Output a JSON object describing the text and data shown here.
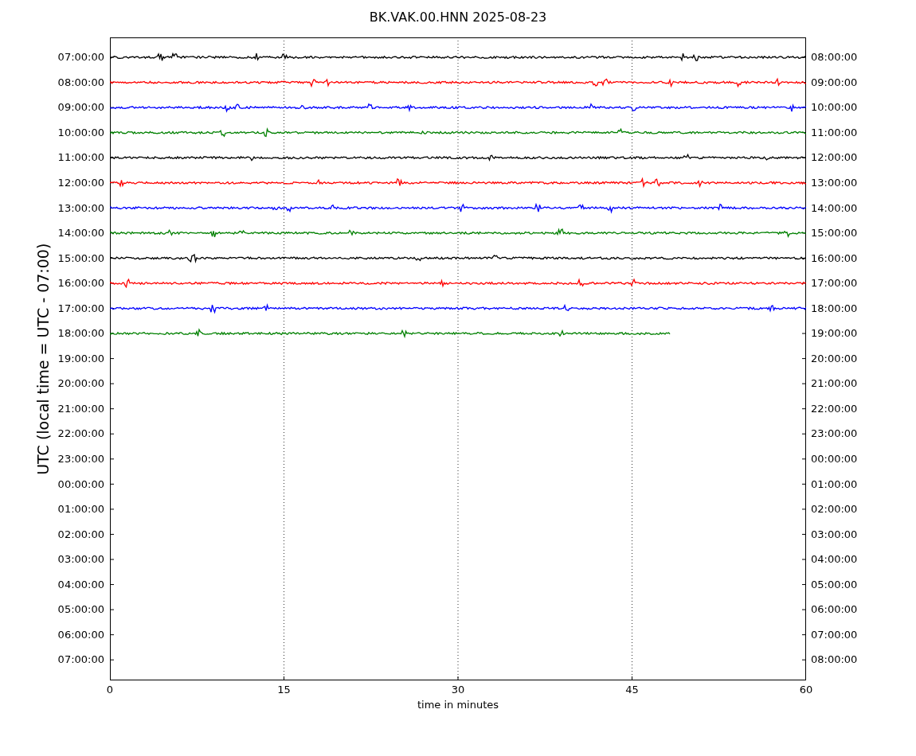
{
  "title": "BK.VAK.00.HNN 2025-08-23",
  "ylabel": "UTC (local time = UTC - 07:00)",
  "xlabel": "time in minutes",
  "xticks": [
    "0",
    "15",
    "30",
    "45",
    "60"
  ],
  "left_labels": [
    "07:00:00",
    "08:00:00",
    "09:00:00",
    "10:00:00",
    "11:00:00",
    "12:00:00",
    "13:00:00",
    "14:00:00",
    "15:00:00",
    "16:00:00",
    "17:00:00",
    "18:00:00",
    "19:00:00",
    "20:00:00",
    "21:00:00",
    "22:00:00",
    "23:00:00",
    "00:00:00",
    "01:00:00",
    "02:00:00",
    "03:00:00",
    "04:00:00",
    "05:00:00",
    "06:00:00",
    "07:00:00"
  ],
  "right_labels": [
    "08:00:00",
    "09:00:00",
    "10:00:00",
    "11:00:00",
    "12:00:00",
    "13:00:00",
    "14:00:00",
    "15:00:00",
    "16:00:00",
    "17:00:00",
    "18:00:00",
    "19:00:00",
    "20:00:00",
    "21:00:00",
    "22:00:00",
    "23:00:00",
    "00:00:00",
    "01:00:00",
    "02:00:00",
    "03:00:00",
    "04:00:00",
    "05:00:00",
    "06:00:00",
    "07:00:00",
    "08:00:00"
  ],
  "traces": [
    {
      "color": "#000000",
      "level": 1
    },
    {
      "color": "#ff0000",
      "level": 1
    },
    {
      "color": "#0000ff",
      "level": 1
    },
    {
      "color": "#008000",
      "level": 1
    },
    {
      "color": "#000000",
      "level": 1
    },
    {
      "color": "#ff0000",
      "level": 1
    },
    {
      "color": "#0000ff",
      "level": 1
    },
    {
      "color": "#008000",
      "level": 1
    },
    {
      "color": "#000000",
      "level": 1
    },
    {
      "color": "#ff0000",
      "level": 1
    },
    {
      "color": "#0000ff",
      "level": 1
    },
    {
      "color": "#008000",
      "level": 0.805
    }
  ]
}
